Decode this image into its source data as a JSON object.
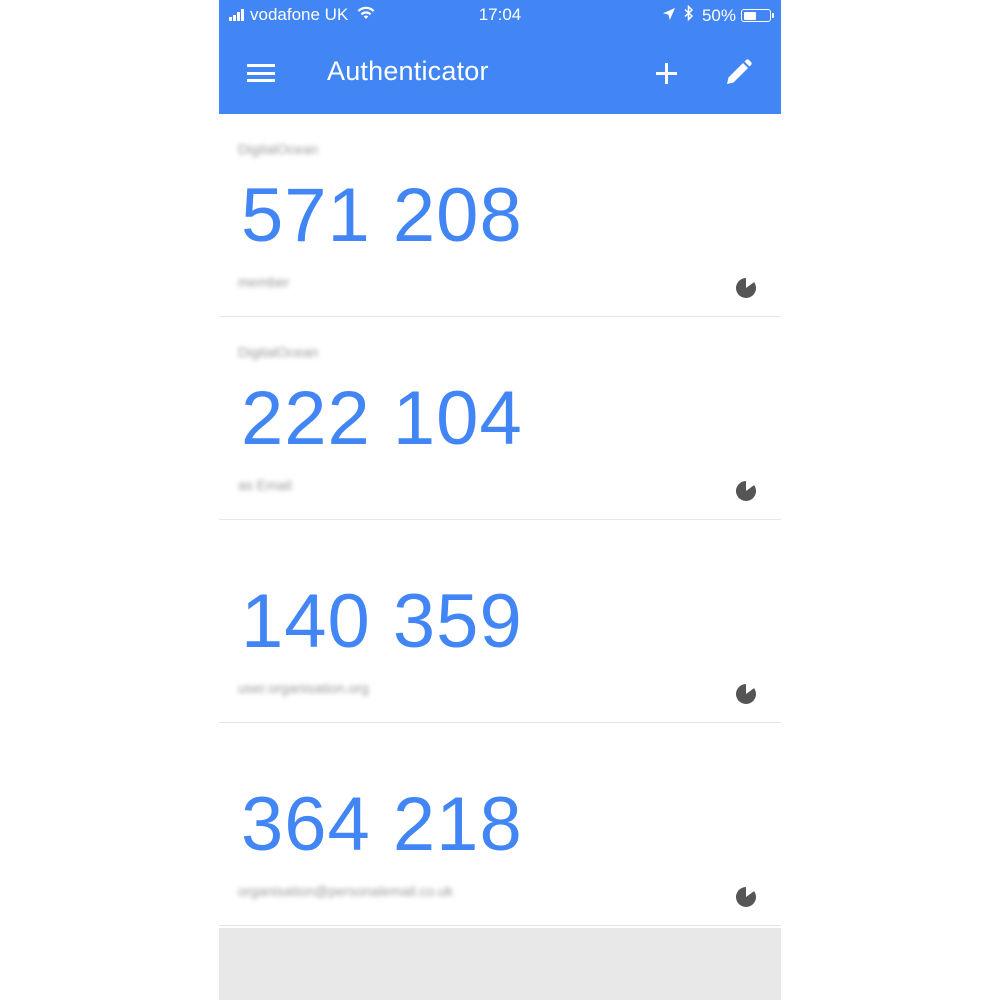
{
  "status_bar": {
    "carrier": "vodafone UK",
    "time": "17:04",
    "battery": "50%",
    "battery_level": 0.5,
    "icons": [
      "signal-icon",
      "wifi-icon",
      "location-icon",
      "bluetooth-icon",
      "battery-icon"
    ]
  },
  "app_bar": {
    "title": "Authenticator",
    "menu_icon": "menu-icon",
    "add_icon": "plus-icon",
    "edit_icon": "pencil-icon"
  },
  "colors": {
    "primary": "#4285f4",
    "code": "#4285f4",
    "muted_text": "#9a9a9a",
    "timer": "#555555",
    "footer": "#e8e8e8"
  },
  "accounts": [
    {
      "issuer": "DigitalOcean",
      "code": "571 208",
      "account": "member",
      "timer_remaining": 0.15
    },
    {
      "issuer": "DigitalOcean",
      "code": "222 104",
      "account": "as Email",
      "timer_remaining": 0.15
    },
    {
      "issuer": "",
      "code": "140 359",
      "account": "user.organisation.org",
      "timer_remaining": 0.15
    },
    {
      "issuer": "",
      "code": "364 218",
      "account": "organisation@personalemail.co.uk",
      "timer_remaining": 0.15
    }
  ]
}
